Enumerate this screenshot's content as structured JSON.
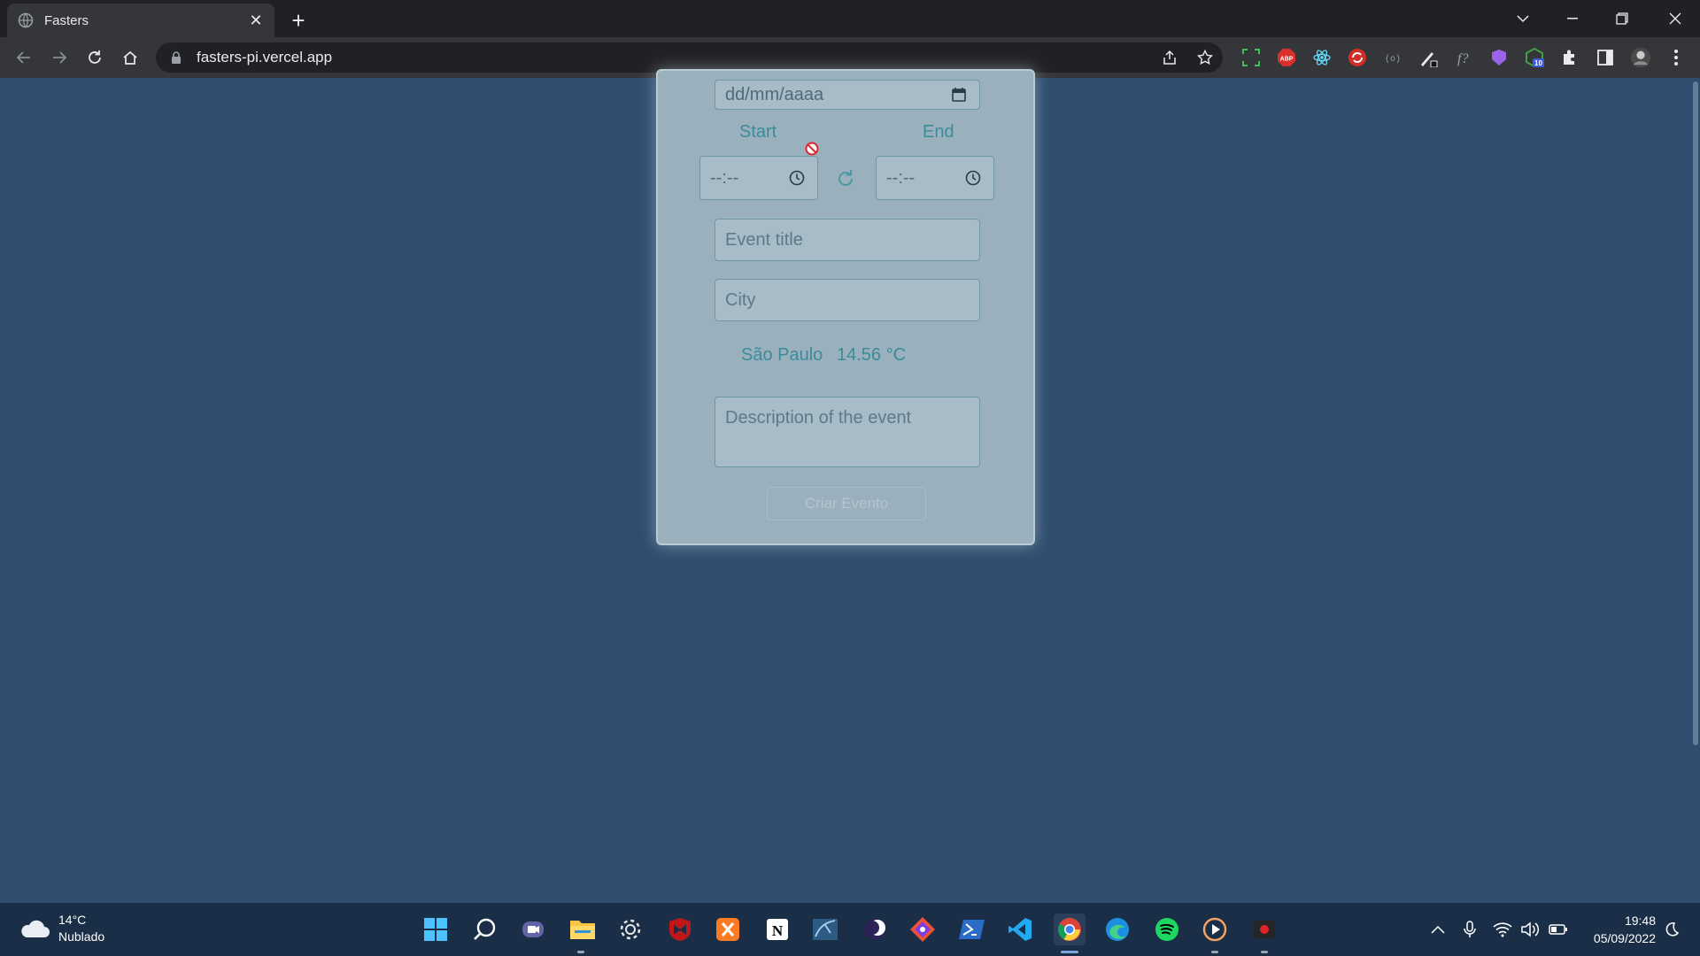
{
  "browser": {
    "tab_title": "Fasters",
    "tab_close": "✕",
    "new_tab": "+",
    "url": "fasters-pi.vercel.app",
    "extension_badge": "10"
  },
  "form": {
    "date_placeholder": "dd/mm/aaaa",
    "start_label": "Start",
    "end_label": "End",
    "start_time": "--:--",
    "end_time": "--:--",
    "title_placeholder": "Event title",
    "city_placeholder": "City",
    "weather_city": "São Paulo",
    "weather_temp": "14.56 °C",
    "description_placeholder": "Description of the event",
    "submit_label": "Criar Evento"
  },
  "taskbar": {
    "weather_temp": "14°C",
    "weather_condition": "Nublado",
    "time": "19:48",
    "date": "05/09/2022"
  }
}
